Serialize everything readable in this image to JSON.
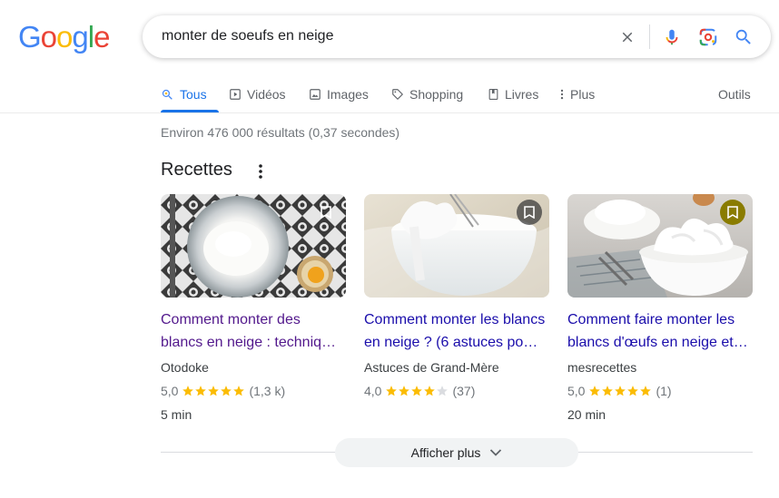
{
  "logo": {
    "letters": [
      {
        "char": "G",
        "color": "#4285f4"
      },
      {
        "char": "o",
        "color": "#ea4335"
      },
      {
        "char": "o",
        "color": "#fbbc05"
      },
      {
        "char": "g",
        "color": "#4285f4"
      },
      {
        "char": "l",
        "color": "#34a853"
      },
      {
        "char": "e",
        "color": "#ea4335"
      }
    ]
  },
  "search": {
    "query": "monter de soeufs en neige",
    "icons": [
      "clear-icon",
      "microphone-icon",
      "lens-icon",
      "search-icon"
    ]
  },
  "tabs": [
    {
      "label": "Tous",
      "icon": "search-icon",
      "active": true
    },
    {
      "label": "Vidéos",
      "icon": "video-icon",
      "active": false
    },
    {
      "label": "Images",
      "icon": "image-icon",
      "active": false
    },
    {
      "label": "Shopping",
      "icon": "tag-icon",
      "active": false
    },
    {
      "label": "Livres",
      "icon": "book-icon",
      "active": false
    },
    {
      "label": "Plus",
      "icon": "more-vert-icon",
      "active": false
    }
  ],
  "tools_label": "Outils",
  "result_stats": "Environ 476 000 résultats (0,37 secondes)",
  "recipes": {
    "title": "Recettes",
    "cards": [
      {
        "title": "Comment monter des blancs en neige : techniq…",
        "source": "Otodoke",
        "rating": "5,0",
        "stars": 5,
        "count": "(1,3 k)",
        "time": "5 min",
        "visited": true,
        "bookmark_color": "#5f6368"
      },
      {
        "title": "Comment monter les blancs en neige ? (6 astuces po…",
        "source": "Astuces de Grand-Mère",
        "rating": "4,0",
        "stars": 4,
        "count": "(37)",
        "time": "",
        "visited": false,
        "bookmark_color": "#5f6368"
      },
      {
        "title": "Comment faire monter les blancs d'œufs en neige et…",
        "source": "mesrecettes",
        "rating": "5,0",
        "stars": 5,
        "count": "(1)",
        "time": "20 min",
        "visited": false,
        "bookmark_color": "#8a7c00"
      }
    ],
    "more_label": "Afficher plus"
  },
  "colors": {
    "accent": "#1a73e8",
    "star": "#fbbc04",
    "star_empty": "#dadce0",
    "link_visited": "#52188c",
    "link": "#1a0dab"
  }
}
